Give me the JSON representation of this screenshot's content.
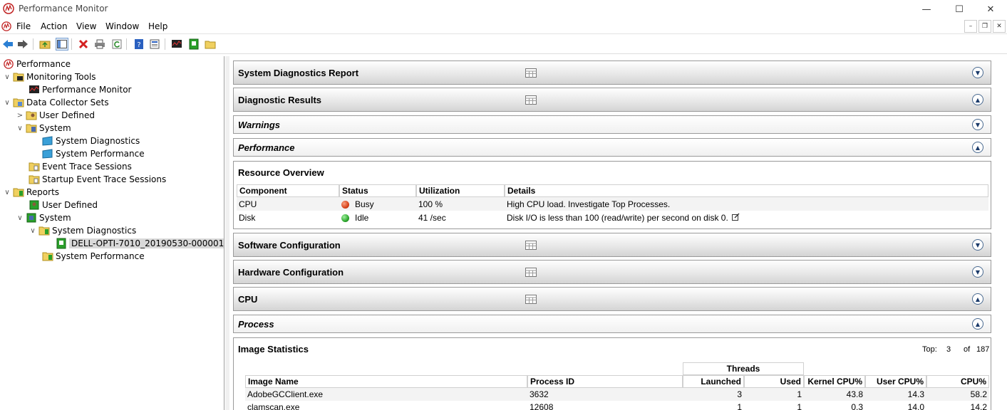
{
  "window": {
    "title": "Performance Monitor"
  },
  "menu": [
    "File",
    "Action",
    "View",
    "Window",
    "Help"
  ],
  "tree": {
    "root": "Performance",
    "monitoring_tools": "Monitoring Tools",
    "performance_monitor": "Performance Monitor",
    "data_collector_sets": "Data Collector Sets",
    "dcs_user_defined": "User Defined",
    "dcs_system": "System",
    "system_diagnostics": "System Diagnostics",
    "system_performance": "System Performance",
    "event_trace_sessions": "Event Trace Sessions",
    "startup_event_trace_sessions": "Startup Event Trace Sessions",
    "reports": "Reports",
    "rep_user_defined": "User Defined",
    "rep_system": "System",
    "rep_system_diagnostics": "System Diagnostics",
    "report_item": "DELL-OPTI-7010_20190530-000001",
    "rep_system_performance": "System Performance"
  },
  "sections": {
    "report": "System Diagnostics Report",
    "diagnostic_results": "Diagnostic Results",
    "warnings": "Warnings",
    "performance": "Performance",
    "resource_overview": "Resource Overview",
    "software_configuration": "Software Configuration",
    "hardware_configuration": "Hardware Configuration",
    "cpu": "CPU",
    "process": "Process",
    "image_statistics": "Image Statistics"
  },
  "resource_overview": {
    "columns": [
      "Component",
      "Status",
      "Utilization",
      "Details"
    ],
    "rows": [
      {
        "component": "CPU",
        "status": "Busy",
        "status_color": "#d9441c",
        "utilization": "100 %",
        "details": "High CPU load. Investigate Top Processes."
      },
      {
        "component": "Disk",
        "status": "Idle",
        "status_color": "#2ea82e",
        "utilization": "41 /sec",
        "details": "Disk I/O is less than 100 (read/write) per second on disk 0."
      }
    ]
  },
  "image_statistics": {
    "top_label": "Top:",
    "top_value": "3",
    "of_label": "of",
    "of_value": "187",
    "group_header": "Threads",
    "columns": [
      "Image Name",
      "Process ID",
      "Launched",
      "Used",
      "Kernel CPU%",
      "User CPU%",
      "CPU%"
    ],
    "rows": [
      {
        "name": "AdobeGCClient.exe",
        "pid": "3632",
        "launched": "3",
        "used": "1",
        "kernel": "43.8",
        "user": "14.3",
        "cpu": "58.2"
      },
      {
        "name": "clamscan.exe",
        "pid": "12608",
        "launched": "1",
        "used": "1",
        "kernel": "0.3",
        "user": "14.0",
        "cpu": "14.2"
      }
    ]
  }
}
